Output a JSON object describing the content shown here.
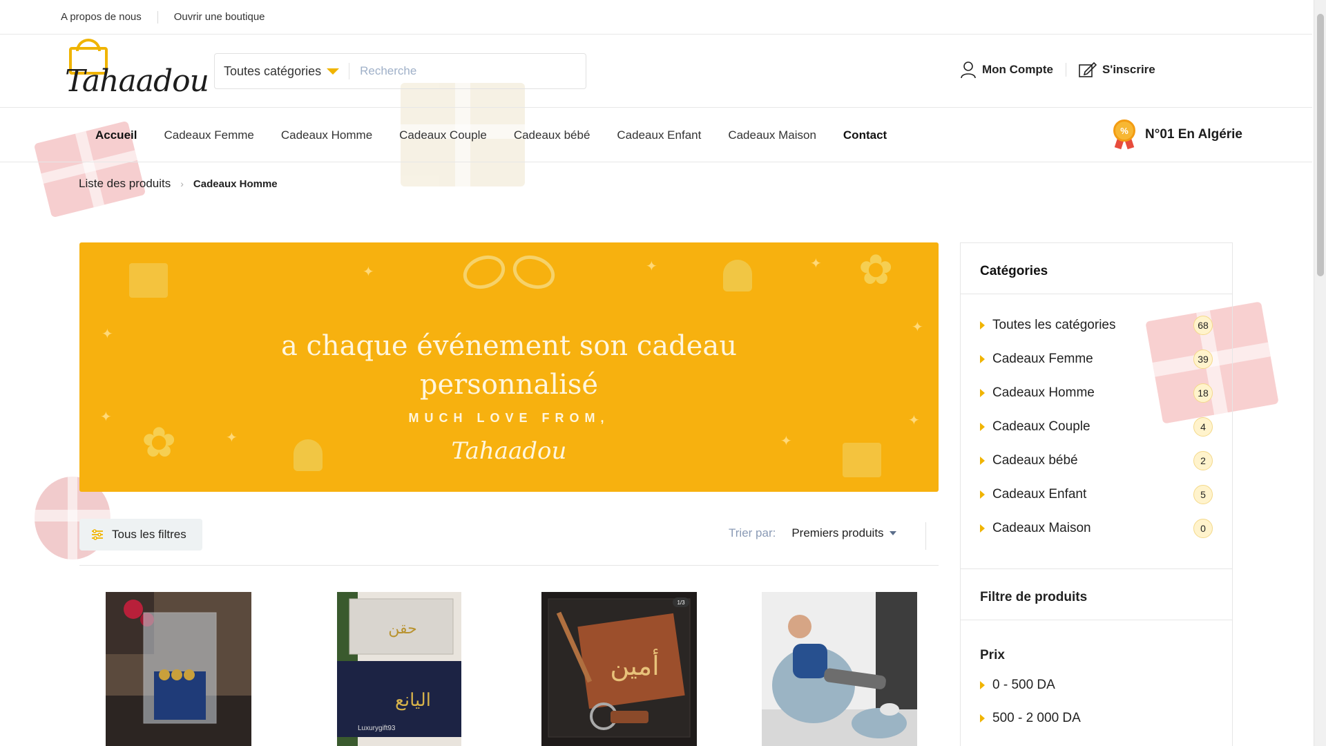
{
  "topbar": {
    "about": "A propos de nous",
    "open_shop": "Ouvrir une boutique"
  },
  "logo": {
    "text": "Tahaadou"
  },
  "search": {
    "category": "Toutes catégories",
    "placeholder": "Recherche"
  },
  "account": {
    "my_account": "Mon Compte",
    "register": "S'inscrire"
  },
  "nav": {
    "items": [
      "Accueil",
      "Cadeaux Femme",
      "Cadeaux Homme",
      "Cadeaux Couple",
      "Cadeaux bébé",
      "Cadeaux Enfant",
      "Cadeaux Maison",
      "Contact"
    ],
    "badge": "N°01 En Algérie",
    "badge_symbol": "%"
  },
  "breadcrumb": {
    "root": "Liste des produits",
    "current": "Cadeaux Homme"
  },
  "banner": {
    "line1": "a chaque événement son cadeau",
    "line2": "personnalisé",
    "sub": "MUCH LOVE FROM,",
    "signature": "Tahaadou",
    "color": "#f7b10f"
  },
  "toolbar": {
    "filters": "Tous les filtres",
    "sort_label": "Trier par:",
    "sort_value": "Premiers produits"
  },
  "products": [
    {
      "icon": "gift-box-chocolates-image"
    },
    {
      "icon": "quran-gift-box-image",
      "caption": "Luxurygift93"
    },
    {
      "icon": "leather-wallet-pen-image",
      "counter": "1/3"
    },
    {
      "icon": "inflatable-chair-man-image"
    }
  ],
  "sidebar": {
    "categories_title": "Catégories",
    "categories": [
      {
        "label": "Toutes les catégories",
        "count": "68"
      },
      {
        "label": "Cadeaux Femme",
        "count": "39"
      },
      {
        "label": "Cadeaux Homme",
        "count": "18"
      },
      {
        "label": "Cadeaux Couple",
        "count": "4"
      },
      {
        "label": "Cadeaux bébé",
        "count": "2"
      },
      {
        "label": "Cadeaux Enfant",
        "count": "5"
      },
      {
        "label": "Cadeaux Maison",
        "count": "0"
      }
    ],
    "filter_title": "Filtre de produits",
    "price_title": "Prix",
    "prices": [
      "0 - 500 DA",
      "500 - 2 000 DA"
    ]
  },
  "colors": {
    "accent": "#f0b400",
    "banner": "#f7b10f",
    "muted": "#8a9ab5"
  }
}
